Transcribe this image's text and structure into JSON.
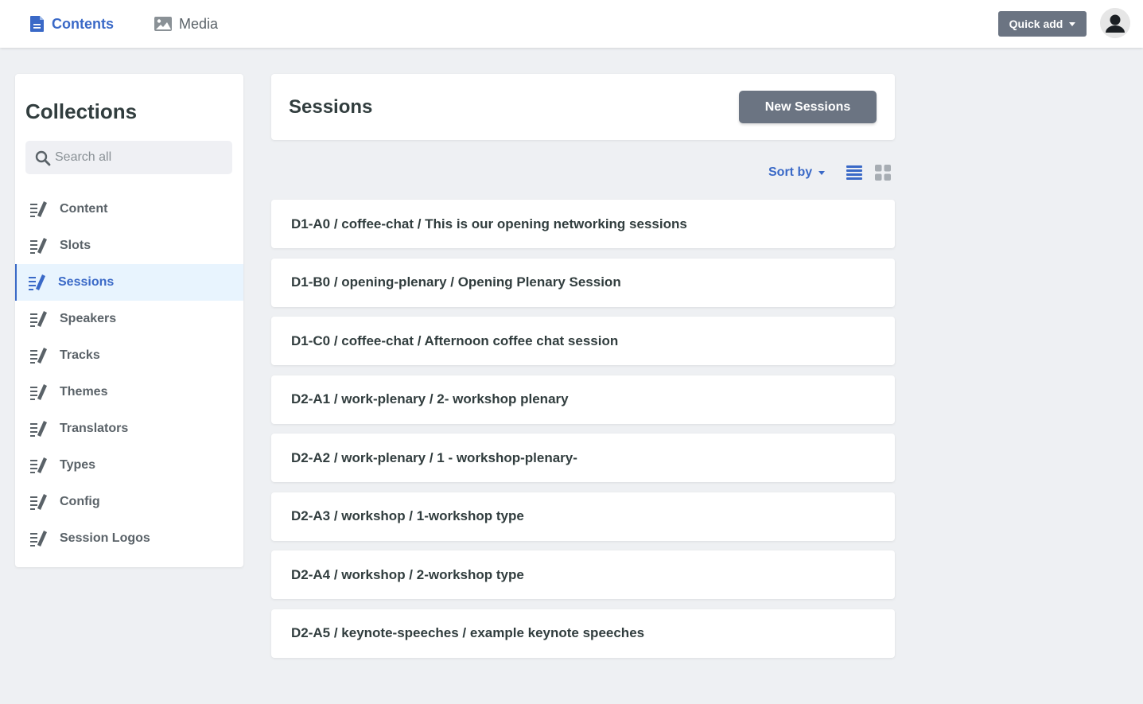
{
  "topbar": {
    "nav": [
      {
        "label": "Contents",
        "icon": "document-icon",
        "active": true
      },
      {
        "label": "Media",
        "icon": "image-icon",
        "active": false
      }
    ],
    "quick_add_label": "Quick add"
  },
  "sidebar": {
    "title": "Collections",
    "search_placeholder": "Search all",
    "items": [
      {
        "label": "Content"
      },
      {
        "label": "Slots"
      },
      {
        "label": "Sessions",
        "active": true
      },
      {
        "label": "Speakers"
      },
      {
        "label": "Tracks"
      },
      {
        "label": "Themes"
      },
      {
        "label": "Translators"
      },
      {
        "label": "Types"
      },
      {
        "label": "Config"
      },
      {
        "label": "Session Logos"
      }
    ]
  },
  "main": {
    "title": "Sessions",
    "new_button_label": "New Sessions",
    "sort_label": "Sort by",
    "entries": [
      "D1-A0 / coffee-chat / This is our opening networking sessions",
      "D1-B0 / opening-plenary / Opening Plenary Session",
      "D1-C0 / coffee-chat / Afternoon coffee chat session",
      "D2-A1 / work-plenary / 2- workshop plenary",
      "D2-A2 / work-plenary / 1 - workshop-plenary-",
      "D2-A3 / workshop / 1-workshop type",
      "D2-A4 / workshop / 2-workshop type",
      "D2-A5 / keynote-speeches / example keynote speeches"
    ]
  },
  "colors": {
    "accent": "#3a69c7",
    "button": "#6b7482",
    "background": "#eef0f3",
    "active_item_bg": "#e8f4fe"
  }
}
